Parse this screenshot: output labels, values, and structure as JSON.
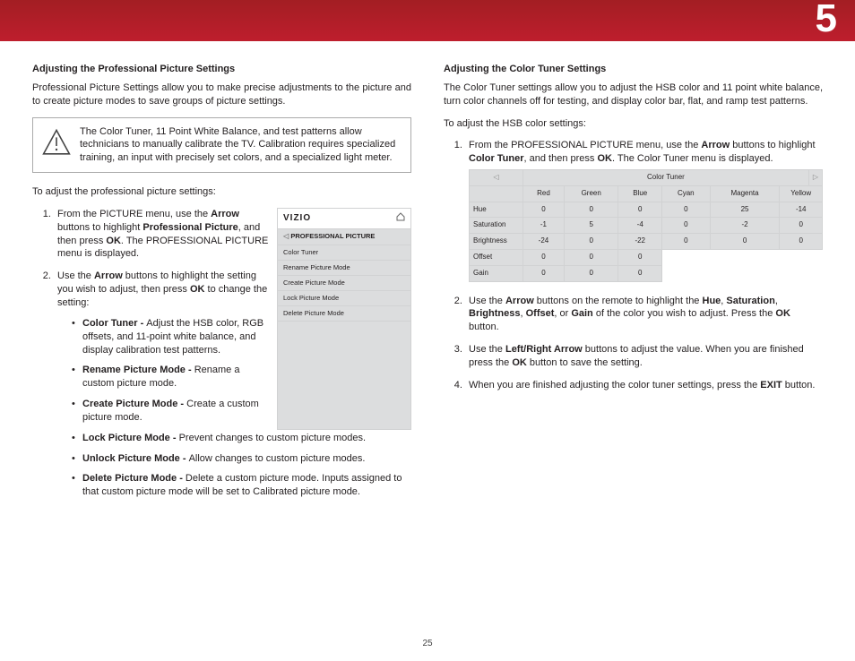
{
  "chapter": "5",
  "page_number": "25",
  "left": {
    "heading": "Adjusting the Professional Picture Settings",
    "intro": "Professional Picture Settings allow you to make precise adjustments to the picture and to create picture modes to save groups of picture settings.",
    "note": "The Color Tuner, 11 Point White Balance, and test patterns allow technicians to manually calibrate the TV. Calibration requires specialized training, an input with precisely set colors, and a specialized light meter.",
    "lead": "To adjust the professional picture settings:",
    "step1_a": "From the PICTURE menu, use the ",
    "arrow": "Arrow",
    "step1_b": " buttons to highlight ",
    "prof_pic": "Professional Picture",
    "step1_c": ", and then press ",
    "ok": "OK",
    "step1_d": ". The PROFESSIONAL PICTURE menu is displayed.",
    "step2_a": "Use the ",
    "step2_b": " buttons to highlight the setting you wish to adjust, then press ",
    "step2_c": " to change the setting:",
    "bullets": [
      {
        "t": "Color Tuner - ",
        "d": "Adjust the HSB color, RGB offsets, and 11-point white balance, and display calibration test patterns."
      },
      {
        "t": "Rename Picture Mode - ",
        "d": "Rename a custom picture mode."
      },
      {
        "t": "Create Picture Mode - ",
        "d": "Create a custom picture mode."
      },
      {
        "t": "Lock Picture Mode - ",
        "d": "Prevent changes to custom picture modes."
      },
      {
        "t": "Unlock Picture Mode - ",
        "d": "Allow changes to custom picture modes."
      },
      {
        "t": "Delete Picture Mode - ",
        "d": "Delete a custom picture mode. Inputs assigned to that custom picture mode will be set to Calibrated picture mode."
      }
    ],
    "fig": {
      "brand": "VIZIO",
      "menu_title": "PROFESSIONAL PICTURE",
      "items": [
        "Color Tuner",
        "Rename Picture Mode",
        "Create Picture Mode",
        "Lock Picture Mode",
        "Delete Picture Mode"
      ]
    }
  },
  "right": {
    "heading": "Adjusting the Color Tuner Settings",
    "intro": "The Color Tuner settings allow you to adjust the HSB color and 11 point white balance, turn color channels off for testing, and display color bar, flat, and ramp test patterns.",
    "lead": "To adjust the HSB color settings:",
    "step1_a": "From the PROFESSIONAL PICTURE menu, use the ",
    "step1_b": " buttons to highlight ",
    "ct": "Color Tuner",
    "step1_c": ", and then press ",
    "step1_d": ". The Color Tuner menu is displayed.",
    "step2_a": "Use the ",
    "step2_b": " buttons on the remote to highlight the ",
    "hue": "Hue",
    "sat": "Saturation",
    "bri": "Brightness",
    "off": "Offset",
    "gain": "Gain",
    "step2_c": " of the color you wish to adjust. Press the ",
    "step2_d": "  button.",
    "step3_a": "Use the ",
    "lr": "Left/Right Arrow",
    "step3_b": " buttons to adjust the value. When you are finished press the ",
    "step3_c": " button to save the setting.",
    "step4_a": "When you are finished adjusting the color tuner settings, press the ",
    "exit": "EXIT",
    "step4_b": " button.",
    "table": {
      "title": "Color Tuner",
      "cols": [
        "Red",
        "Green",
        "Blue",
        "Cyan",
        "Magenta",
        "Yellow"
      ],
      "rows": [
        {
          "h": "Hue",
          "v": [
            "0",
            "0",
            "0",
            "0",
            "25",
            "-14"
          ]
        },
        {
          "h": "Saturation",
          "v": [
            "-1",
            "5",
            "-4",
            "0",
            "-2",
            "0"
          ]
        },
        {
          "h": "Brightness",
          "v": [
            "-24",
            "0",
            "-22",
            "0",
            "0",
            "0"
          ]
        },
        {
          "h": "Offset",
          "v": [
            "0",
            "0",
            "0"
          ]
        },
        {
          "h": "Gain",
          "v": [
            "0",
            "0",
            "0"
          ]
        }
      ]
    }
  }
}
